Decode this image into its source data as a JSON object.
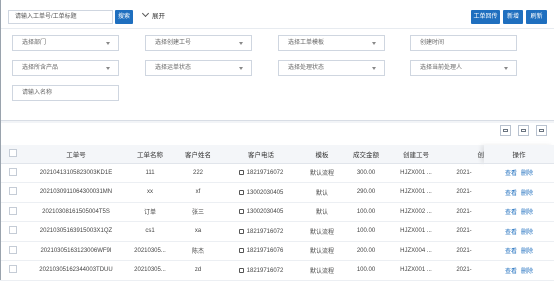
{
  "search": {
    "placeholder": "请输入工单号/工单标题",
    "button": "搜索",
    "expand": "展开"
  },
  "toolbar": {
    "btn1": "工单回传",
    "btn2": "新增",
    "btn3": "刷新"
  },
  "filters": {
    "dept": "选择部门",
    "creator_no": "选择创建工号",
    "template": "选择工单模板",
    "created_time": "创建时间",
    "product": "选择所含产品",
    "ship_status": "选择运单状态",
    "process_status": "选择处理状态",
    "current_handler": "选择当前处理人",
    "customer_name": "请输入名称"
  },
  "table": {
    "headers": [
      "工单号",
      "工单名称",
      "客户姓名",
      "客户电话",
      "模板",
      "成交金额",
      "创建工号",
      "创",
      "操作"
    ],
    "rows": [
      [
        "20210413105823003KD1E",
        "111",
        "222",
        "18219716072",
        "默认流程",
        "300.00",
        "HJZX001 ...",
        "2021-",
        "查看",
        "删除"
      ],
      [
        "2021030911064300031MN",
        "xx",
        "xf",
        "13002030405",
        "默认",
        "290.00",
        "HJZX001 ...",
        "2021-",
        "查看",
        "删除"
      ],
      [
        "20210308161505004T5S",
        "订单",
        "张三",
        "13002030405",
        "默认",
        "100.00",
        "HJZX002 ...",
        "2021-",
        "查看",
        "删除"
      ],
      [
        "20210305163915003X1QZ",
        "cs1",
        "xa",
        "18219716072",
        "默认流程",
        "100.00",
        "HJZX001 ...",
        "2021-",
        "查看",
        "删除"
      ],
      [
        "20210305163123006WF9I",
        "20210305...",
        "陈杰",
        "18219716076",
        "默认流程",
        "200.00",
        "HJZX004 ...",
        "2021-",
        "查看",
        "删除"
      ],
      [
        "20210305162344003TDUU",
        "20210305...",
        "zd",
        "18219716072",
        "默认流程",
        "100.00",
        "HJZX001 ...",
        "2021-",
        "查看",
        "删除"
      ]
    ]
  }
}
